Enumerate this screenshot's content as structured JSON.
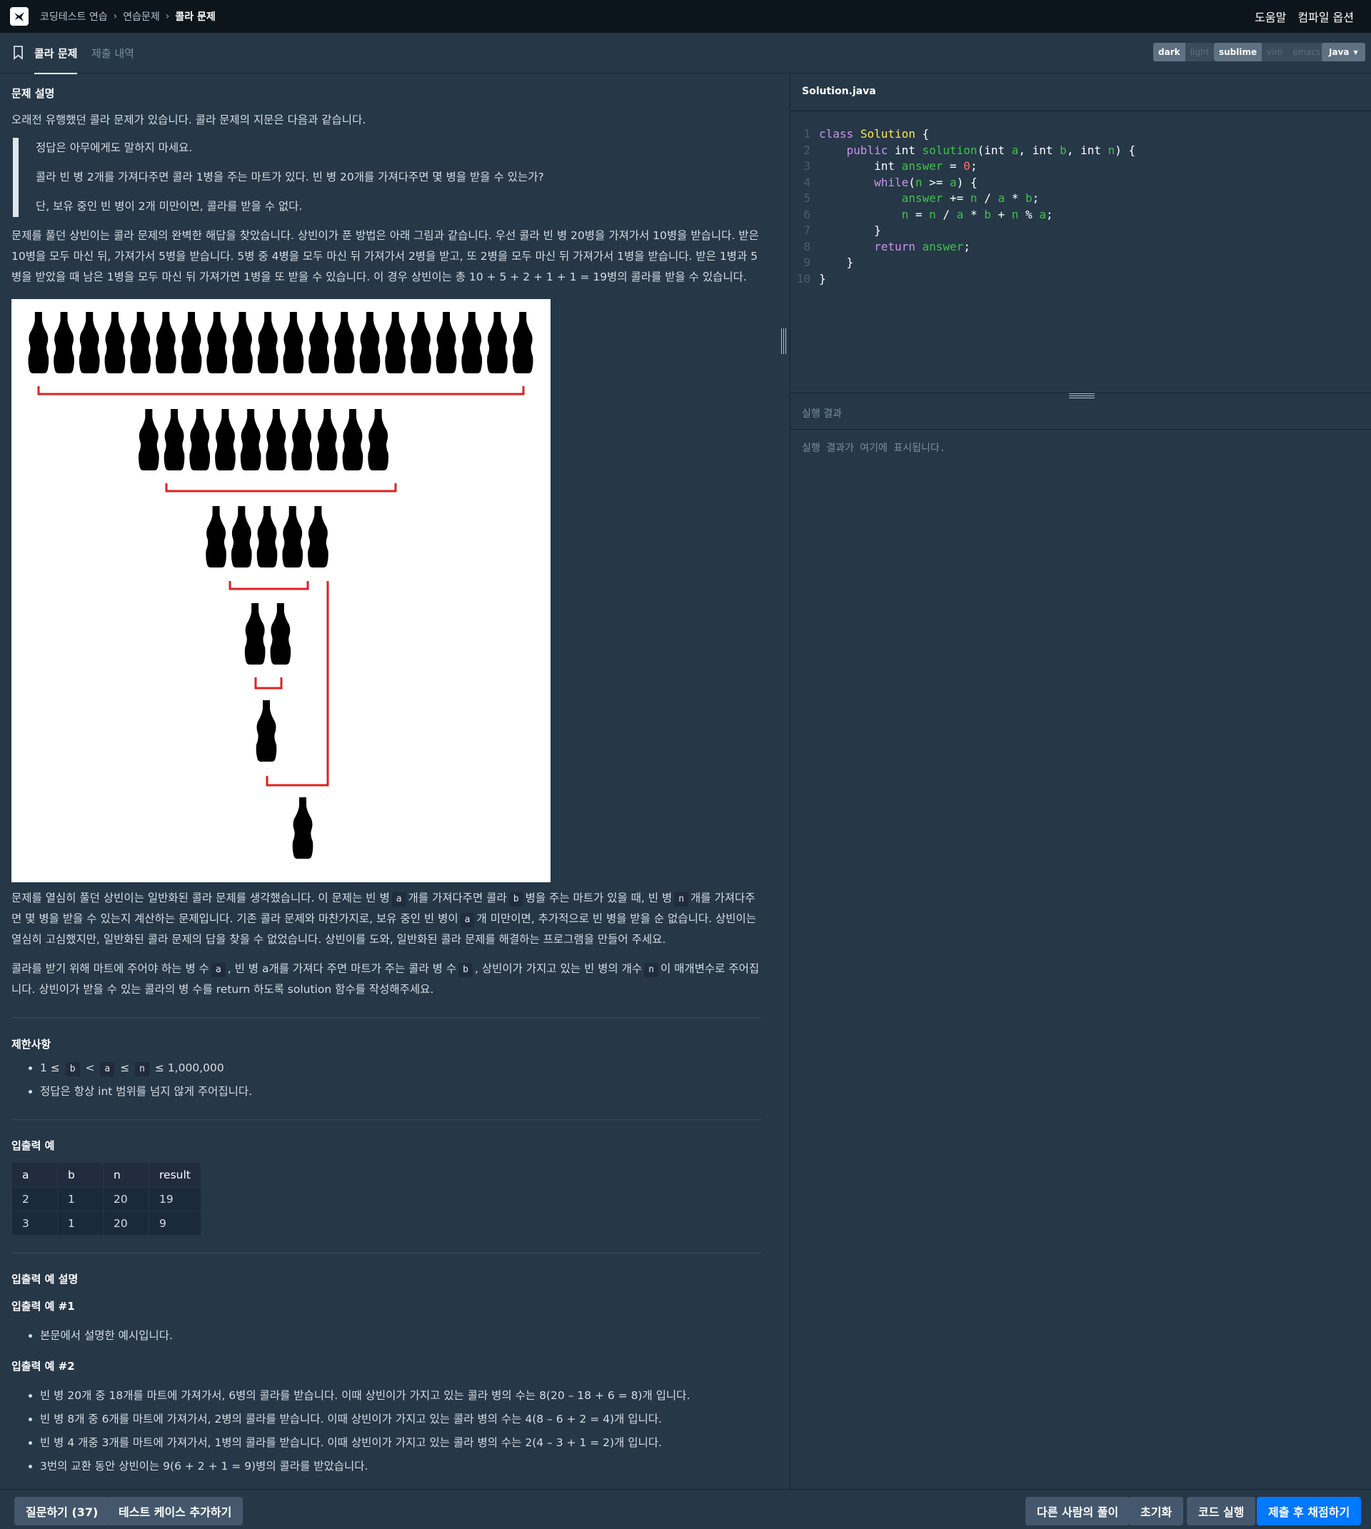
{
  "nav": {
    "breadcrumbs": [
      "코딩테스트 연습",
      "연습문제",
      "콜라 문제"
    ],
    "help": "도움말",
    "compile_options": "컴파일 옵션"
  },
  "tabs": {
    "problem": "콜라 문제",
    "history": "제출 내역"
  },
  "editor_options": {
    "theme": [
      "dark",
      "light"
    ],
    "keymap": [
      "sublime",
      "vim",
      "emacs"
    ],
    "language": "Java"
  },
  "problem": {
    "section_title": "문제 설명",
    "intro": "오래전 유행했던 콜라 문제가 있습니다. 콜라 문제의 지문은 다음과 같습니다.",
    "quote": [
      "정답은 아무에게도 말하지 마세요.",
      "콜라 빈 병 2개를 가져다주면 콜라 1병을 주는 마트가 있다. 빈 병 20개를 가져다주면 몇 병을 받을 수 있는가?",
      "단, 보유 중인 빈 병이 2개 미만이면, 콜라를 받을 수 없다."
    ],
    "story": "문제를 풀던 상빈이는 콜라 문제의 완벽한 해답을 찾았습니다. 상빈이가 푼 방법은 아래 그림과 같습니다. 우선 콜라 빈 병 20병을 가져가서 10병을 받습니다. 받은 10병을 모두 마신 뒤, 가져가서 5병을 받습니다. 5병 중 4병을 모두 마신 뒤 가져가서 2병을 받고, 또 2병을 모두 마신 뒤 가져가서 1병을 받습니다. 받은 1병과 5병을 받았을 때 남은 1병을 모두 마신 뒤 가져가면 1병을 또 받을 수 있습니다. 이 경우 상빈이는 총 10 + 5 + 2 + 1 + 1 = 19병의 콜라를 받을 수 있습니다.",
    "general_1": "문제를 열심히 풀던 상빈이는 일반화된 콜라 문제를 생각했습니다. 이 문제는 빈 병",
    "general_2": "개를 가져다주면 콜라",
    "general_3": "병을 주는 마트가 있을 때, 빈 병",
    "general_4": "개를 가져다주면 몇 병을 받을 수 있는지 계산하는 문제입니다. 기존 콜라 문제와 마찬가지로, 보유 중인 빈 병이",
    "general_5": "개 미만이면, 추가적으로 빈 병을 받을 순 없습니다. 상빈이는 열심히 고심했지만, 일반화된 콜라 문제의 답을 찾을 수 없었습니다. 상빈이를 도와, 일반화된 콜라 문제를 해결하는 프로그램을 만들어 주세요.",
    "params_1": "콜라를 받기 위해 마트에 주어야 하는 병 수",
    "params_2": ", 빈 병 a개를 가져다 주면 마트가 주는 콜라 병 수",
    "params_3": ", 상빈이가 가지고 있는 빈 병의 개수",
    "params_4": "이 매개변수로 주어집니다. 상빈이가 받을 수 있는 콜라의 병 수를 return 하도록 solution 함수를 작성해주세요.",
    "var_a": "a",
    "var_b": "b",
    "var_n": "n"
  },
  "constraints": {
    "title": "제한사항",
    "c1_prefix": "1 ≤",
    "lt": "<",
    "le": "≤",
    "c1_suffix": "≤ 1,000,000",
    "c2": "정답은 항상 int 범위를 넘지 않게 주어집니다."
  },
  "examples": {
    "title": "입출력 예",
    "headers": [
      "a",
      "b",
      "n",
      "result"
    ],
    "rows": [
      [
        "2",
        "1",
        "20",
        "19"
      ],
      [
        "3",
        "1",
        "20",
        "9"
      ]
    ]
  },
  "explanation": {
    "title": "입출력 예 설명",
    "ex1_title": "입출력 예 #1",
    "ex1_items": [
      "본문에서 설명한 예시입니다."
    ],
    "ex2_title": "입출력 예 #2",
    "ex2_items": [
      "빈 병 20개 중 18개를 마트에 가져가서, 6병의 콜라를 받습니다. 이때 상빈이가 가지고 있는 콜라 병의 수는 8(20 – 18 + 6 = 8)개 입니다.",
      "빈 병 8개 중 6개를 마트에 가져가서, 2병의 콜라를 받습니다. 이때 상빈이가 가지고 있는 콜라 병의 수는 4(8 – 6 + 2 = 4)개 입니다.",
      "빈 병 4 개중 3개를 마트에 가져가서, 1병의 콜라를 받습니다. 이때 상빈이가 가지고 있는 콜라 병의 수는 2(4 – 3 + 1 = 2)개 입니다.",
      "3번의 교환 동안 상빈이는 9(6 + 2 + 1 = 9)병의 콜라를 받았습니다."
    ]
  },
  "figure": {
    "bottle_rows": [
      20,
      10,
      5,
      2,
      1,
      1
    ]
  },
  "editor": {
    "filename": "Solution.java",
    "line_numbers": [
      "1",
      "2",
      "3",
      "4",
      "5",
      "6",
      "7",
      "8",
      "9",
      "10"
    ],
    "result_title": "실행 결과",
    "result_placeholder": "실행 결과가 여기에 표시됩니다."
  },
  "footer": {
    "ask": "질문하기 (37)",
    "add_testcase": "테스트 케이스 추가하기",
    "others": "다른 사람의 풀이",
    "reset": "초기화",
    "run": "코드 실행",
    "submit": "제출 후 채점하기"
  },
  "colors": {
    "background": "#263747",
    "topbar": "#0c151c",
    "primary": "#0078ff",
    "bracket": "#e02020"
  }
}
